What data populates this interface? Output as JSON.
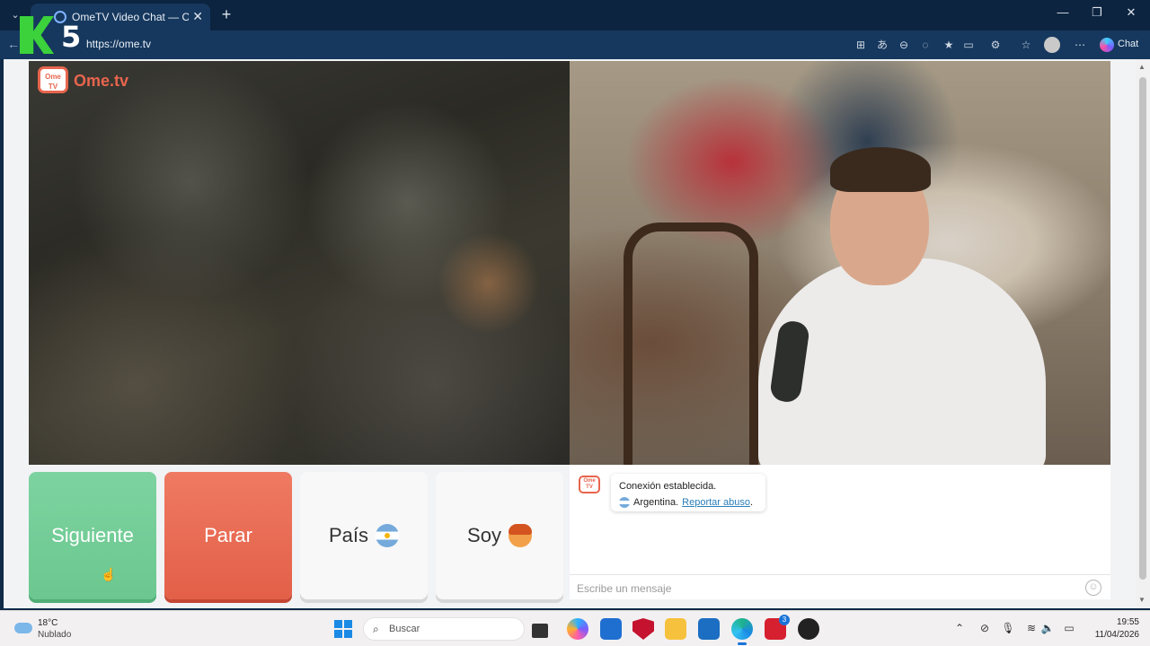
{
  "browser": {
    "tab_title": "OmeTV Video Chat — Omegl",
    "new_tab_symbol": "+",
    "url": "https://ome.tv",
    "copilot_label": "Chat",
    "watermark_number": "5"
  },
  "page": {
    "logo_box_text": "Ome TV",
    "logo_word": "Ome.tv",
    "buttons": {
      "next": "Siguiente",
      "stop": "Parar",
      "country": "País",
      "gender": "Soy"
    },
    "chat": {
      "avatar_text": "Ome TV",
      "connection_message": "Conexión establecida.",
      "country_name": "Argentina.",
      "report_link": "Reportar abuso",
      "report_suffix": ".",
      "input_placeholder": "Escribe un mensaje",
      "emoji_icon": "smiley-icon"
    },
    "colors": {
      "brand": "#e8654e",
      "next_button": "#6bc78f",
      "stop_button": "#e35f48",
      "link": "#2a7fb8"
    }
  },
  "taskbar": {
    "weather_temp": "18°C",
    "weather_condition": "Nublado",
    "search_label": "Buscar",
    "app_badge": "3",
    "time": "19:55",
    "date": "11/04/2026"
  }
}
